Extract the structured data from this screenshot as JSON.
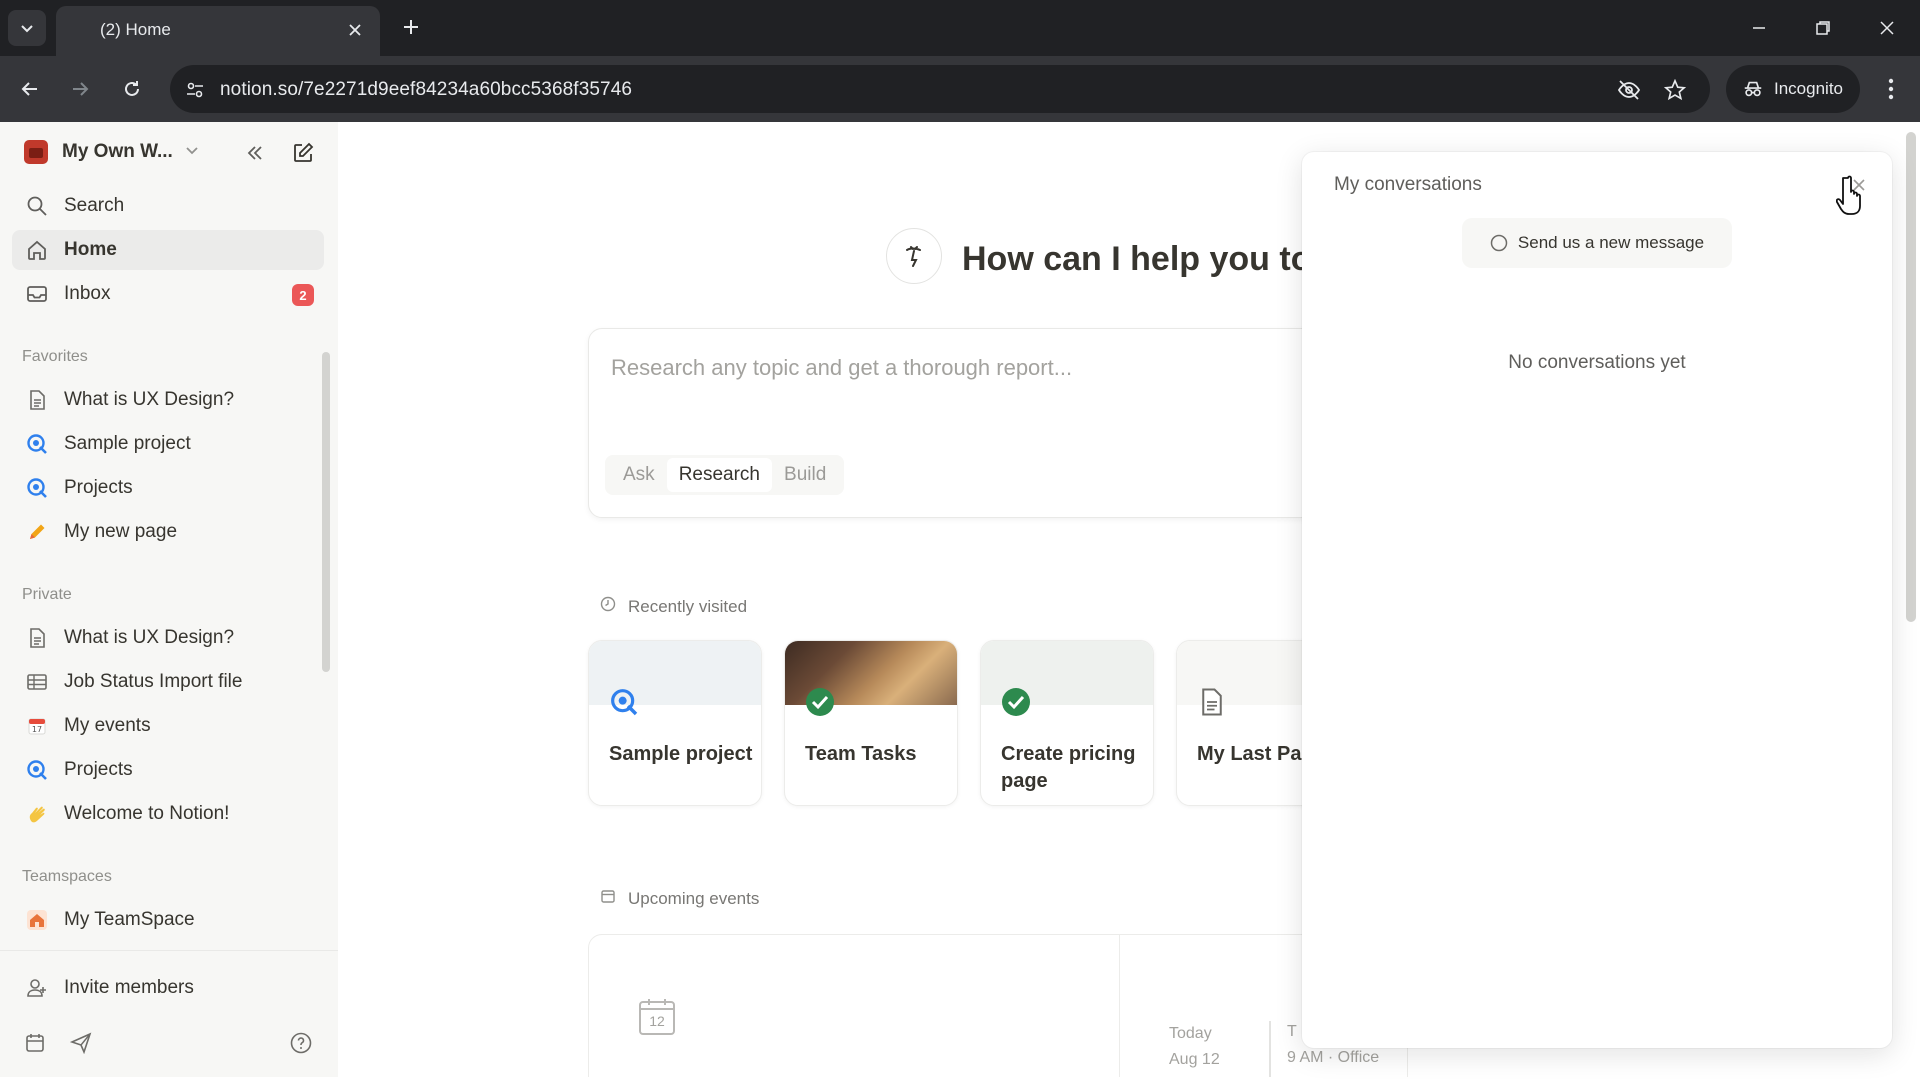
{
  "browser": {
    "tab_title": "(2) Home",
    "url": "notion.so/7e2271d9eef84234a60bcc5368f35746",
    "incognito_label": "Incognito"
  },
  "sidebar": {
    "workspace_name": "My Own W...",
    "nav": [
      {
        "label": "Search",
        "icon": "search-icon"
      },
      {
        "label": "Home",
        "icon": "home-icon",
        "active": true
      },
      {
        "label": "Inbox",
        "icon": "inbox-icon",
        "badge": "2"
      }
    ],
    "favorites_label": "Favorites",
    "favorites": [
      {
        "label": "What is UX Design?",
        "icon": "document-icon"
      },
      {
        "label": "Sample project",
        "icon": "project-icon"
      },
      {
        "label": "Projects",
        "icon": "project-icon"
      },
      {
        "label": "My new page",
        "icon": "pencil-icon"
      }
    ],
    "private_label": "Private",
    "private": [
      {
        "label": "What is UX Design?",
        "icon": "document-icon"
      },
      {
        "label": "Job Status Import file",
        "icon": "table-icon"
      },
      {
        "label": "My events",
        "icon": "calendar-icon"
      },
      {
        "label": "Projects",
        "icon": "project-icon"
      },
      {
        "label": "Welcome to Notion!",
        "icon": "wave-icon"
      }
    ],
    "teamspaces_label": "Teamspaces",
    "teamspaces": [
      {
        "label": "My TeamSpace",
        "icon": "house-icon"
      }
    ],
    "invite_label": "Invite members"
  },
  "main": {
    "hero_title": "How can I help you to",
    "prompt_placeholder": "Research any topic and get a thorough report...",
    "modes": [
      "Ask",
      "Research",
      "Build"
    ],
    "selected_mode": "Research",
    "recently_visited_label": "Recently visited",
    "recent_cards": [
      {
        "title": "Sample project",
        "icon": "project-icon"
      },
      {
        "title": "Team Tasks",
        "icon": "check-circle-icon"
      },
      {
        "title": "Create pricing page",
        "icon": "check-circle-icon"
      },
      {
        "title": "My Last Pag",
        "icon": "document-icon"
      }
    ],
    "upcoming_events_label": "Upcoming events",
    "event": {
      "calendar_day": "12",
      "day": "Today",
      "date": "Aug 12",
      "line1": "T",
      "line2": "9 AM · Office"
    }
  },
  "panel": {
    "title": "My conversations",
    "new_message_label": "Send us a new message",
    "empty_text": "No conversations yet"
  },
  "colors": {
    "accent_blue": "#2f80ed",
    "badge_red": "#eb5757",
    "check_green": "#2d8a4e"
  }
}
